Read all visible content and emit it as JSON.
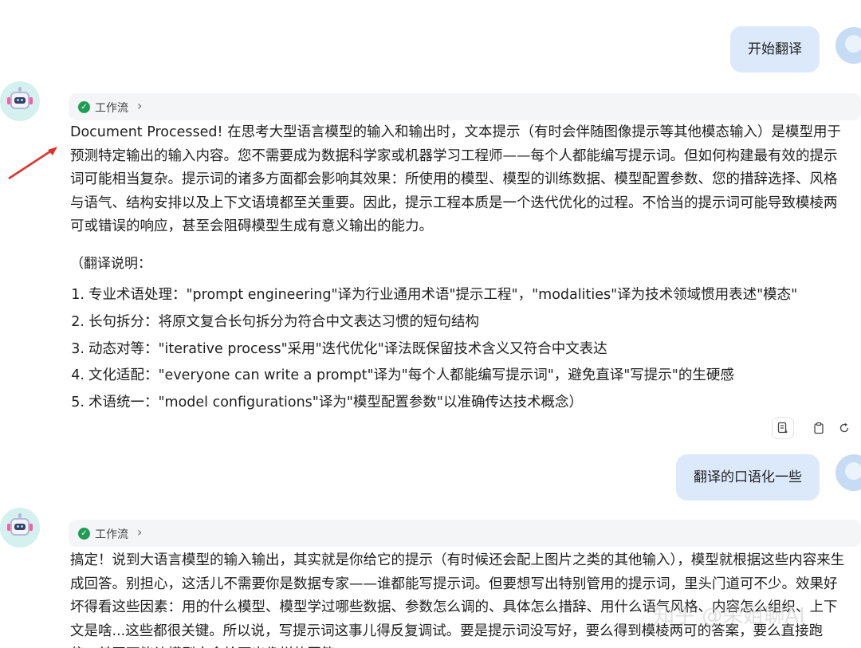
{
  "conversation": {
    "user_message_1": "开始翻译",
    "workflow_label": "工作流",
    "reply_1_paragraph": "Document Processed! 在思考大型语言模型的输入和输出时，文本提示（有时会伴随图像提示等其他模态输入）是模型用于预测特定输出的输入内容。您不需要成为数据科学家或机器学习工程师——每个人都能编写提示词。但如何构建最有效的提示词可能相当复杂。提示词的诸多方面都会影响其效果：所使用的模型、模型的训练数据、模型配置参数、您的措辞选择、风格与语气、结构安排以及上下文语境都至关重要。因此，提示工程本质是一个迭代优化的过程。不恰当的提示词可能导致模棱两可或错误的响应，甚至会阻碍模型生成有意义输出的能力。",
    "reply_1_note_heading": "（翻译说明：",
    "reply_1_notes": [
      {
        "num": "1.",
        "text": "专业术语处理：\"prompt engineering\"译为行业通用术语\"提示工程\"，\"modalities\"译为技术领域惯用表述\"模态\""
      },
      {
        "num": "2.",
        "text": "长句拆分：将原文复合长句拆分为符合中文表达习惯的短句结构"
      },
      {
        "num": "3.",
        "text": "动态对等：\"iterative process\"采用\"迭代优化\"译法既保留技术含义又符合中文表达"
      },
      {
        "num": "4.",
        "text": "文化适配：\"everyone can write a prompt\"译为\"每个人都能编写提示词\"，避免直译\"写提示\"的生硬感"
      },
      {
        "num": "5.",
        "text": "术语统一：\"model configurations\"译为\"模型配置参数\"以准确传达技术概念）"
      }
    ],
    "user_message_2": "翻译的口语化一些",
    "reply_2_paragraph": "搞定！说到大语言模型的输入输出，其实就是你给它的提示（有时候还会配上图片之类的其他输入），模型就根据这些内容来生成回答。别担心，这活儿不需要你是数据专家——谁都能写提示词。但要想写出特别管用的提示词，里头门道可不少。效果好坏得看这些因素：用的什么模型、模型学过哪些数据、参数怎么调的、具体怎么措辞、用什么语气风格、内容怎么组织、上下文是啥...这些都很关键。所以说，写提示词这事儿得反复调试。要是提示词没写好，要么得到模棱两可的答案，要么直接跑偏，甚至可能让模型完全给不出像样的回答。"
  },
  "actions": {
    "copy_text_icon": "document-text-icon",
    "clipboard_icon": "clipboard-icon",
    "regenerate_icon": "refresh-icon"
  },
  "watermark": "知乎 @荣姐聊AI",
  "colors": {
    "user_bubble": "#dbe9fb",
    "workflow_check": "#1f9d55",
    "arrow": "#e0322b"
  }
}
